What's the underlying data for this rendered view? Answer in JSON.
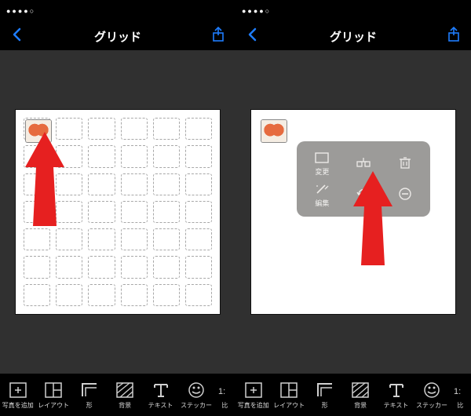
{
  "header": {
    "title": "グリッド",
    "back_icon": "back-icon",
    "share_icon": "share-icon"
  },
  "popup": {
    "items": [
      {
        "label": "変更",
        "icon": "change-icon"
      },
      {
        "label": "",
        "icon": "grid-icon"
      },
      {
        "label": "",
        "icon": "trash-icon"
      },
      {
        "label": "編集",
        "icon": "wand-icon"
      },
      {
        "label": "",
        "icon": "rotate-icon"
      },
      {
        "label": "",
        "icon": "minus-icon"
      }
    ]
  },
  "toolbar": {
    "items": [
      {
        "label": "写真を追加",
        "icon": "add-photo-icon"
      },
      {
        "label": "レイアウト",
        "icon": "layout-icon"
      },
      {
        "label": "形",
        "icon": "shape-icon"
      },
      {
        "label": "背景",
        "icon": "background-icon"
      },
      {
        "label": "テキスト",
        "icon": "text-icon"
      },
      {
        "label": "ステッカー",
        "icon": "sticker-icon"
      },
      {
        "label": "比",
        "icon": "ratio-icon"
      }
    ]
  }
}
